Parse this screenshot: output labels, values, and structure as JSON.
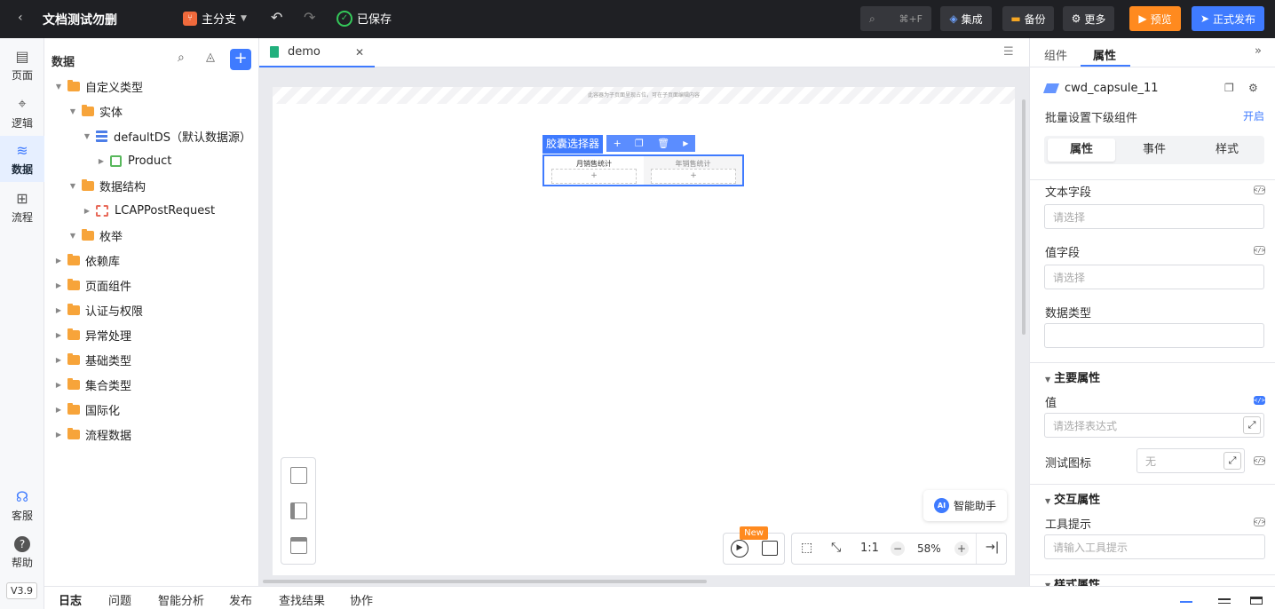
{
  "topbar": {
    "back_icon": "chevron-left-icon",
    "app_title": "文档测试勿删",
    "branch_label": "主分支",
    "saved_label": "已保存",
    "search_shortcut": "⌘+F",
    "integrate_label": "集成",
    "backup_label": "备份",
    "more_label": "更多",
    "preview_label": "预览",
    "publish_label": "正式发布",
    "colors": {
      "preview": "#ff8a1f",
      "publish": "#3f7bff",
      "saved": "#34c759"
    }
  },
  "leftnav": {
    "items": [
      {
        "label": "页面",
        "icon": "page-icon"
      },
      {
        "label": "逻辑",
        "icon": "logic-icon"
      },
      {
        "label": "数据",
        "icon": "database-icon"
      },
      {
        "label": "流程",
        "icon": "flow-icon"
      }
    ],
    "support_label": "客服",
    "help_label": "帮助",
    "version": "V3.9"
  },
  "datapanel": {
    "title": "数据",
    "tree": [
      {
        "label": "自定义类型",
        "level": 0,
        "expanded": true,
        "icon": "folder-icon"
      },
      {
        "label": "实体",
        "level": 1,
        "expanded": true,
        "icon": "folder-icon"
      },
      {
        "label": "defaultDS（默认数据源）",
        "level": 2,
        "expanded": true,
        "icon": "datasource-icon"
      },
      {
        "label": "Product",
        "level": 3,
        "expanded": false,
        "icon": "entity-icon"
      },
      {
        "label": "数据结构",
        "level": 1,
        "expanded": true,
        "icon": "folder-icon"
      },
      {
        "label": "LCAPPostRequest",
        "level": 2,
        "expanded": false,
        "icon": "structure-icon"
      },
      {
        "label": "枚举",
        "level": 1,
        "expanded": true,
        "icon": "folder-icon"
      },
      {
        "label": "依赖库",
        "level": 0,
        "expanded": false,
        "icon": "folder-icon"
      },
      {
        "label": "页面组件",
        "level": 0,
        "expanded": false,
        "icon": "folder-icon"
      },
      {
        "label": "认证与权限",
        "level": 0,
        "expanded": false,
        "icon": "folder-icon"
      },
      {
        "label": "异常处理",
        "level": 0,
        "expanded": false,
        "icon": "folder-icon"
      },
      {
        "label": "基础类型",
        "level": 0,
        "expanded": false,
        "icon": "folder-icon"
      },
      {
        "label": "集合类型",
        "level": 0,
        "expanded": false,
        "icon": "folder-icon"
      },
      {
        "label": "国际化",
        "level": 0,
        "expanded": false,
        "icon": "folder-icon"
      },
      {
        "label": "流程数据",
        "level": 0,
        "expanded": false,
        "icon": "folder-icon"
      }
    ]
  },
  "editor": {
    "tab_label": "demo",
    "page_hint": "此容器为子页面呈现占位，可在子页面编辑内容",
    "component_name": "胶囊选择器",
    "capsule_items": [
      "月销售统计",
      "年销售统计"
    ],
    "ai_label": "智能助手",
    "new_badge": "New",
    "ratio_label": "1:1",
    "zoom": "58%"
  },
  "rightpanel": {
    "tabs": [
      "组件",
      "属性"
    ],
    "active_tab": "属性",
    "component_id": "cwd_capsule_11",
    "batch_label": "批量设置下级组件",
    "batch_toggle": "开启",
    "sub_tabs": [
      "属性",
      "事件",
      "样式"
    ],
    "text_field_label": "文本字段",
    "text_field_placeholder": "请选择",
    "value_field_label": "值字段",
    "value_field_placeholder": "请选择",
    "data_type_label": "数据类型",
    "main_props_label": "主要属性",
    "value_label": "值",
    "value_placeholder": "请选择表达式",
    "test_icon_label": "测试图标",
    "test_icon_value": "无",
    "interaction_label": "交互属性",
    "tooltip_label": "工具提示",
    "tooltip_placeholder": "请输入工具提示",
    "style_props_label": "样式属性"
  },
  "bottombar": {
    "tabs": [
      "日志",
      "问题",
      "智能分析",
      "发布",
      "查找结果",
      "协作"
    ]
  }
}
